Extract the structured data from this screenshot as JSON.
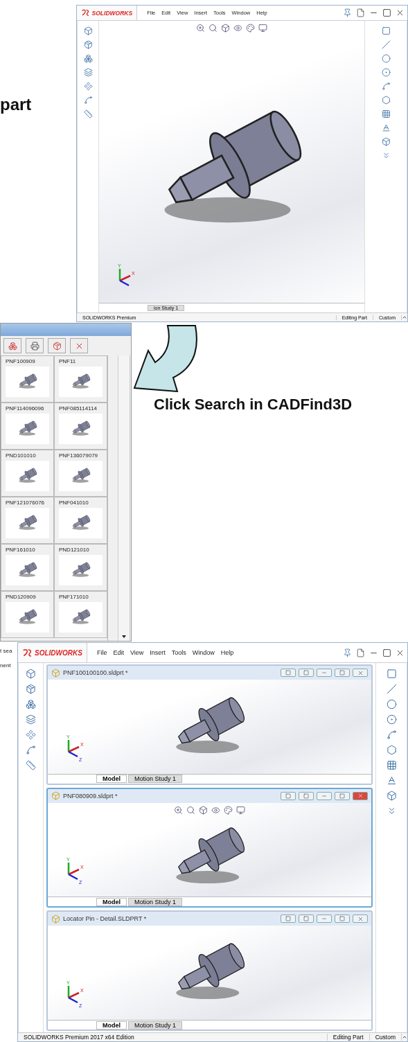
{
  "callout_top": {
    "text": "part"
  },
  "top_window": {
    "logo": "SOLIDWORKS",
    "menu": [
      "File",
      "Edit",
      "View",
      "Insert",
      "Tools",
      "Window",
      "Help"
    ],
    "triad": [
      "Y",
      "X"
    ],
    "tabs": [
      {
        "label": "ion Study 1",
        "selected": false
      }
    ],
    "status": [
      "SOLIDWORKS Premium",
      "Editing Part",
      "Custom"
    ]
  },
  "results_panel": {
    "items": [
      {
        "label": "PNF100909"
      },
      {
        "label": "PNF11"
      },
      {
        "label": "PNF114096096"
      },
      {
        "label": "PNF085114114"
      },
      {
        "label": "PND101010"
      },
      {
        "label": "PNF136079079"
      },
      {
        "label": "PNF121076076"
      },
      {
        "label": "PNF041010"
      },
      {
        "label": "PNF161010"
      },
      {
        "label": "PND121010"
      },
      {
        "label": "PND120909"
      },
      {
        "label": "PNF171010"
      }
    ]
  },
  "callout_search": {
    "text": "Click Search in CADFind3D"
  },
  "bottom_window": {
    "behind_fragments": [
      "t sea",
      "nent"
    ],
    "logo": "SOLIDWORKS",
    "menu": [
      "File",
      "Edit",
      "View",
      "Insert",
      "Tools",
      "Window",
      "Help"
    ],
    "documents": [
      {
        "title": "PNF100100100.sldprt *",
        "active": false,
        "triad": [
          "Y",
          "X",
          "Z"
        ],
        "tabs": [
          {
            "label": "Model",
            "selected": true
          },
          {
            "label": "Motion Study 1",
            "selected": false
          }
        ]
      },
      {
        "title": "PNF080909.sldprt *",
        "active": true,
        "triad": [
          "Y",
          "X",
          "Z"
        ],
        "tabs": [
          {
            "label": "Model",
            "selected": true
          },
          {
            "label": "Motion Study 1",
            "selected": false
          }
        ]
      },
      {
        "title": "Locator Pin - Detail.SLDPRT *",
        "active": false,
        "triad": [
          "Y",
          "X",
          "Z"
        ],
        "tabs": [
          {
            "label": "Model",
            "selected": true
          },
          {
            "label": "Motion Study 1",
            "selected": false
          }
        ]
      }
    ],
    "status": [
      "SOLIDWORKS Premium 2017 x64 Edition",
      "Editing Part",
      "Custom"
    ]
  }
}
